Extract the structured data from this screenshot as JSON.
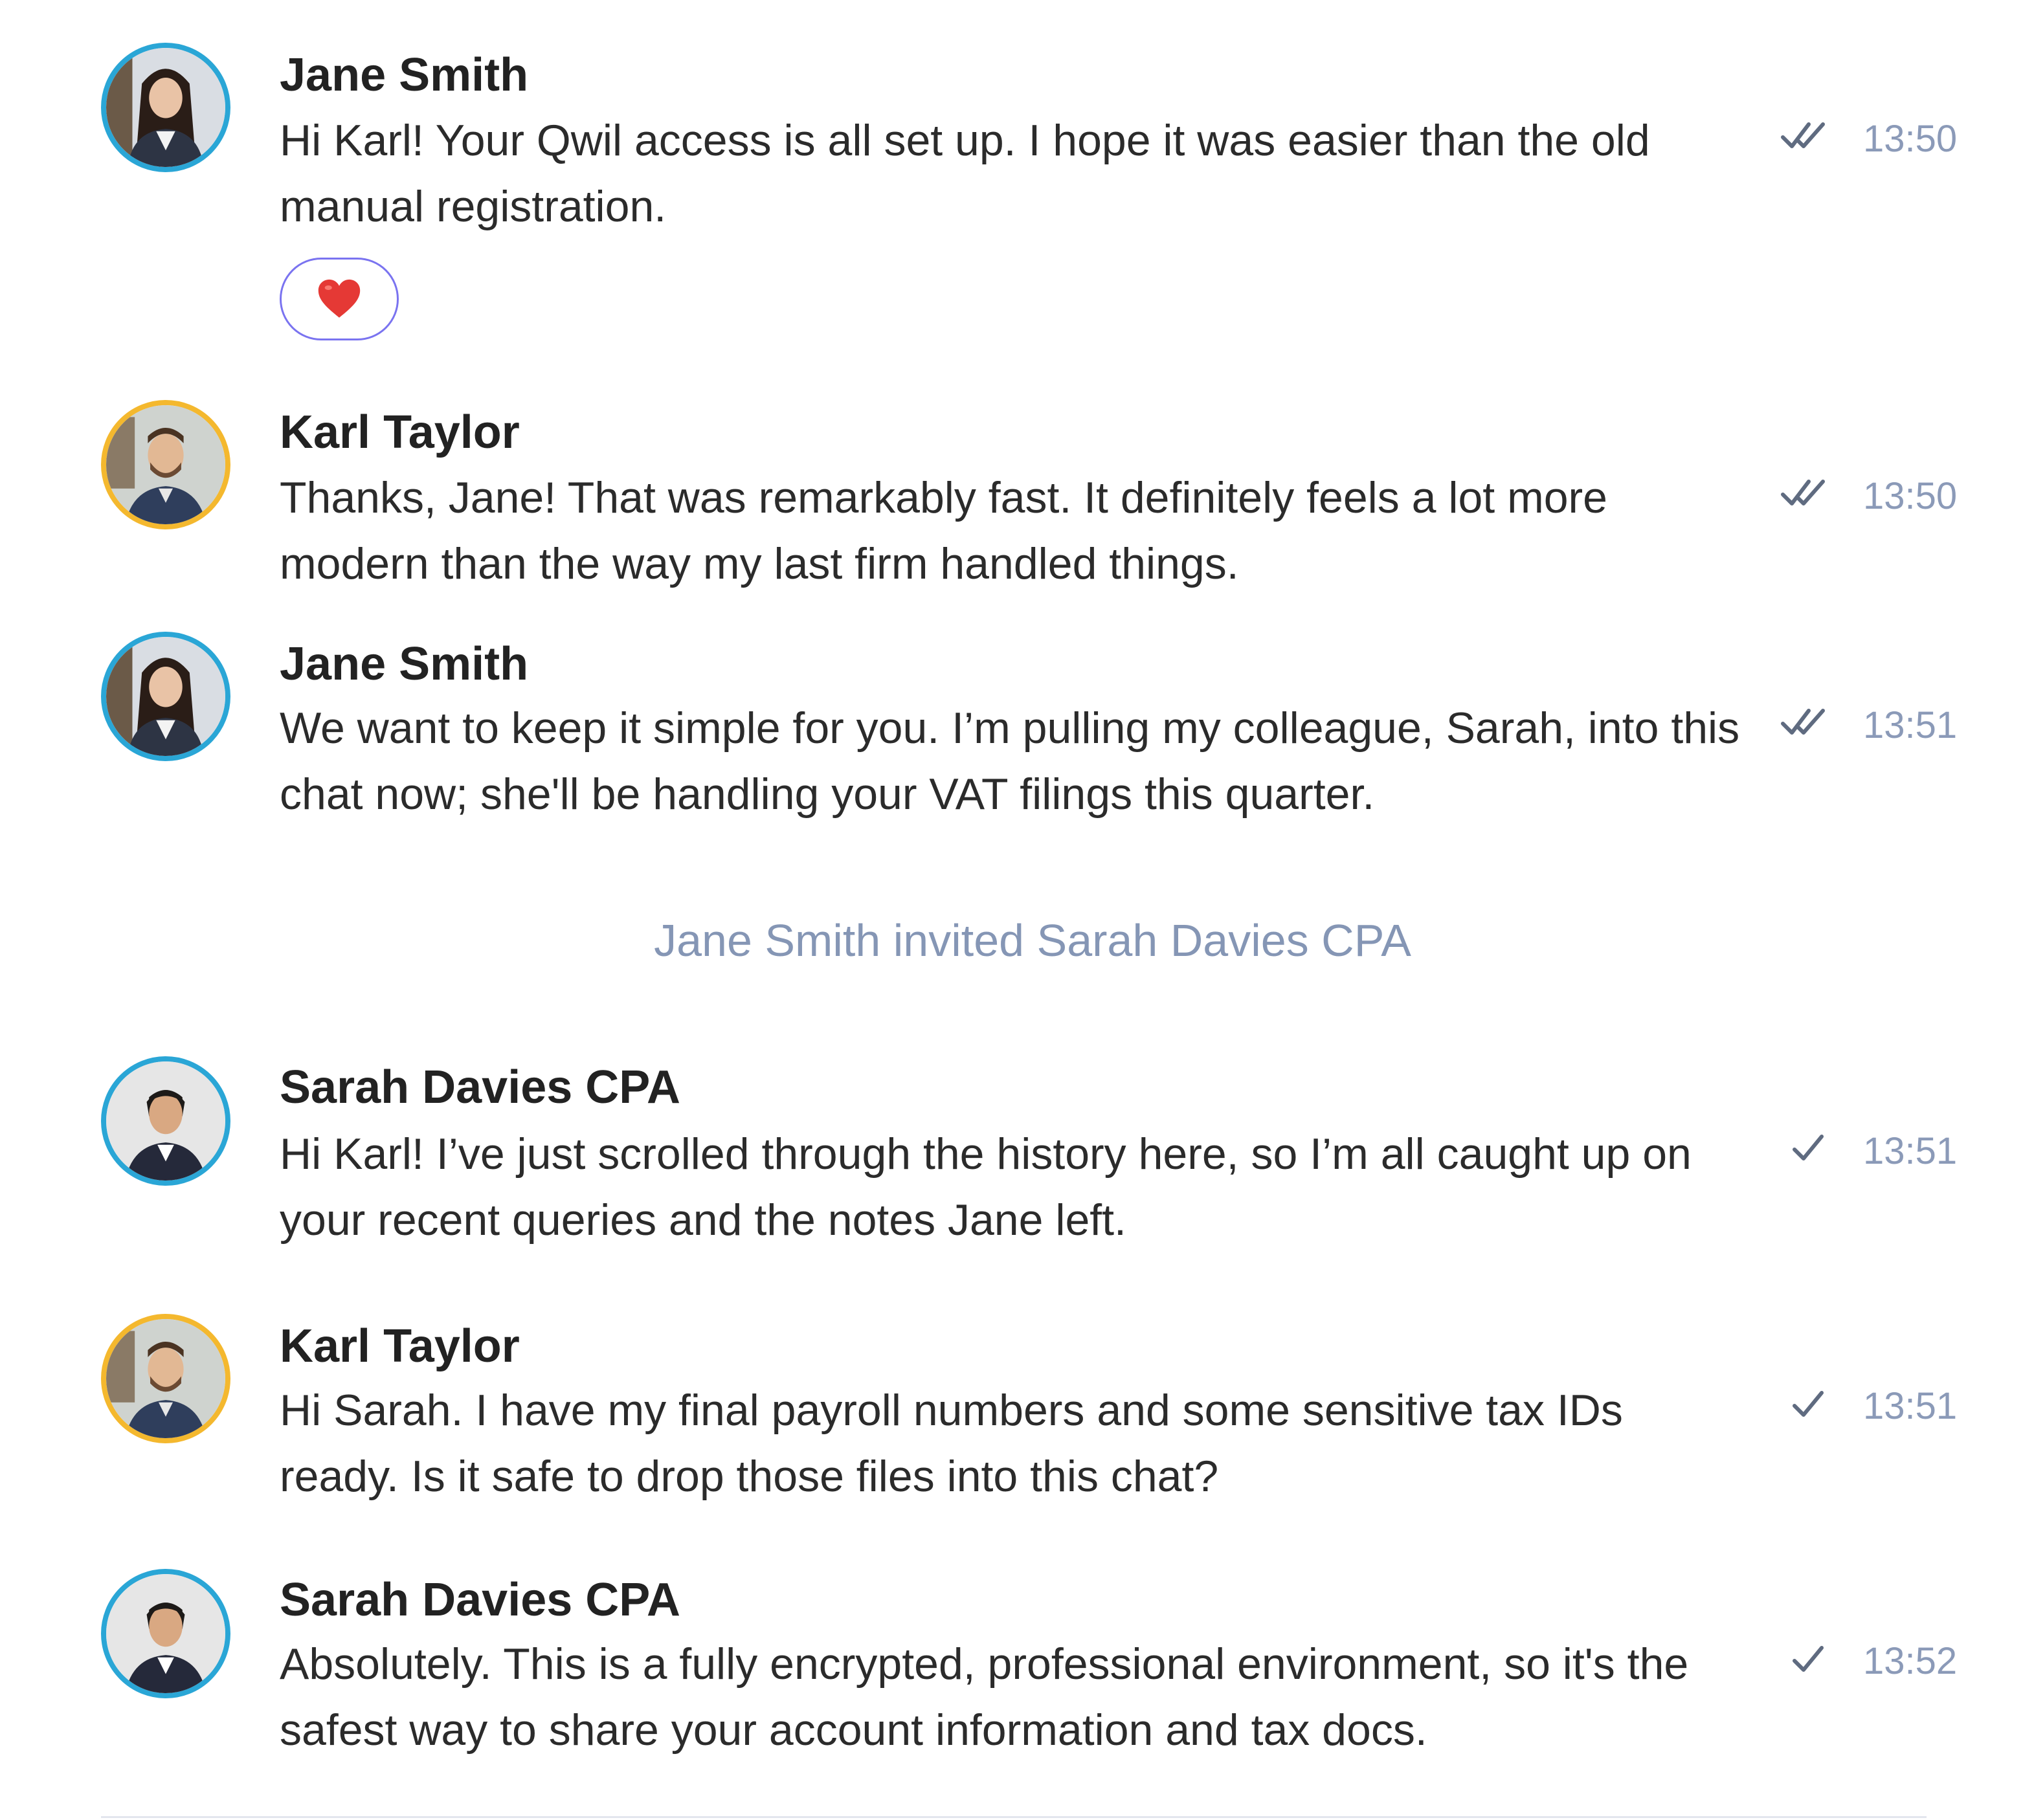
{
  "messages": [
    {
      "sender": "Jane Smith",
      "text": "Hi Karl! Your Qwil access is all set up. I hope it was easier than the old manual registration.",
      "status": "read-double-check",
      "time": "13:50",
      "avatar": "woman-long-dark-hair-avatar",
      "reaction": "❤️"
    },
    {
      "sender": "Karl Taylor",
      "text": "Thanks, Jane! That was remarkably fast. It definitely feels a lot more modern than the way my last firm handled things.",
      "status": "read-double-check",
      "time": "13:50",
      "avatar": "man-short-hair-beard-avatar"
    },
    {
      "sender": "Jane Smith",
      "text": "We want to keep it simple for you. I’m pulling my colleague, Sarah, into this chat now; she'll be handling your VAT filings this quarter.",
      "status": "read-double-check",
      "time": "13:51",
      "avatar": "woman-long-dark-hair-avatar"
    },
    {
      "sender": "Sarah Davies CPA",
      "text": "Hi Karl! I’ve just scrolled through the history here, so I’m all caught up on your recent queries and the notes Jane left.",
      "status": "sent-single-check",
      "time": "13:51",
      "avatar": "woman-dark-hair-tied-avatar"
    },
    {
      "sender": "Karl Taylor",
      "text": "Hi Sarah. I have my final payroll numbers and some sensitive tax IDs ready. Is it safe to drop those files into this chat?",
      "status": "sent-single-check",
      "time": "13:51",
      "avatar": "man-short-hair-beard-avatar"
    },
    {
      "sender": "Sarah Davies CPA",
      "text": "Absolutely. This is a fully encrypted, professional environment, so it's the safest way to share your account information and tax docs.",
      "status": "sent-single-check",
      "time": "13:52",
      "avatar": "woman-dark-hair-tied-avatar"
    }
  ],
  "system_event": {
    "text": "Jane Smith invited Sarah Davies CPA"
  },
  "colors": {
    "avatar_ring_staff": "#2aa6d6",
    "avatar_ring_client": "#f4b82e",
    "timestamp": "#8b9ab8",
    "system_text": "#8596b5",
    "reaction_border": "#7a73f0",
    "heart": "#e53935"
  }
}
